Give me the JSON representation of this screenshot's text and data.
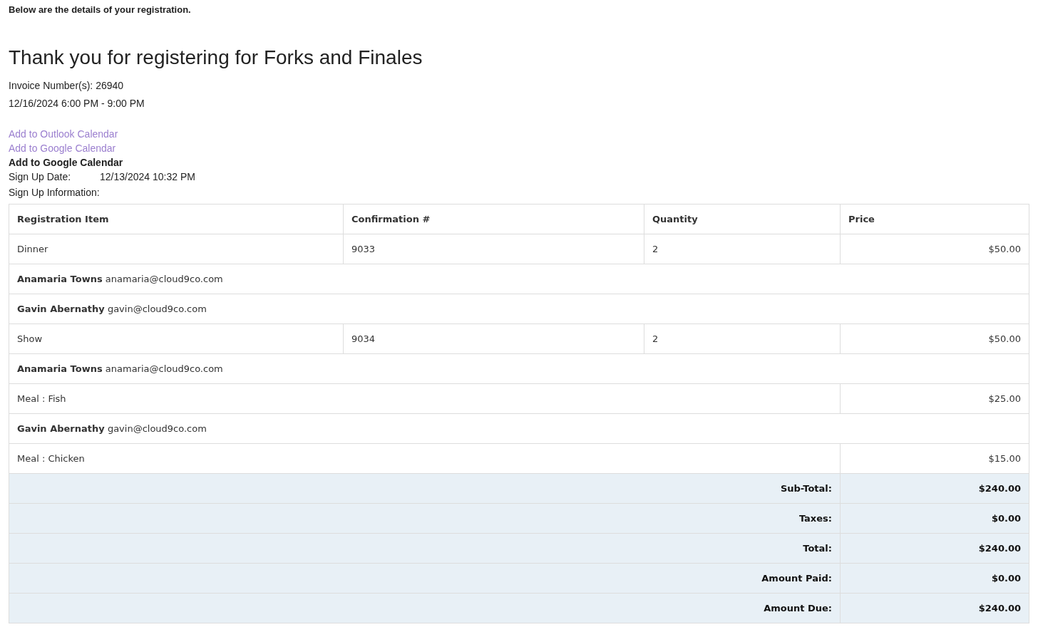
{
  "intro": "Below are the details of your registration.",
  "heading": "Thank you for registering for Forks and Finales",
  "invoice": "Invoice Number(s): 26940",
  "event_time": "12/16/2024 6:00 PM - 9:00 PM",
  "calendar_links": [
    {
      "kind": "link",
      "label": "Add to Outlook Calendar"
    },
    {
      "kind": "link",
      "label": "Add to Google Calendar"
    },
    {
      "kind": "heading",
      "label": "Add to Google Calendar"
    }
  ],
  "sign_up_date": {
    "label": "Sign Up Date:",
    "value": "12/13/2024 10:32 PM"
  },
  "sign_up_info_label": "Sign Up Information:",
  "table": {
    "columns": [
      "Registration Item",
      "Confirmation #",
      "Quantity",
      "Price"
    ],
    "rows": [
      {
        "kind": "item",
        "item": "Dinner",
        "confirmation": "9033",
        "quantity": "2",
        "price": "$50.00"
      },
      {
        "kind": "attendee",
        "name": "Anamaria Towns",
        "email": "anamaria@cloud9co.com"
      },
      {
        "kind": "attendee",
        "name": "Gavin Abernathy",
        "email": "gavin@cloud9co.com"
      },
      {
        "kind": "item",
        "item": "Show",
        "confirmation": "9034",
        "quantity": "2",
        "price": "$50.00"
      },
      {
        "kind": "attendee",
        "name": "Anamaria Towns",
        "email": "anamaria@cloud9co.com"
      },
      {
        "kind": "option",
        "item": "Meal : Fish",
        "price": "$25.00"
      },
      {
        "kind": "attendee",
        "name": "Gavin Abernathy",
        "email": "gavin@cloud9co.com"
      },
      {
        "kind": "option",
        "item": "Meal : Chicken",
        "price": "$15.00"
      }
    ],
    "totals": [
      {
        "label": "Sub-Total:",
        "value": "$240.00"
      },
      {
        "label": "Taxes:",
        "value": "$0.00"
      },
      {
        "label": "Total:",
        "value": "$240.00"
      },
      {
        "label": "Amount Paid:",
        "value": "$0.00"
      },
      {
        "label": "Amount Due:",
        "value": "$240.00"
      }
    ]
  }
}
